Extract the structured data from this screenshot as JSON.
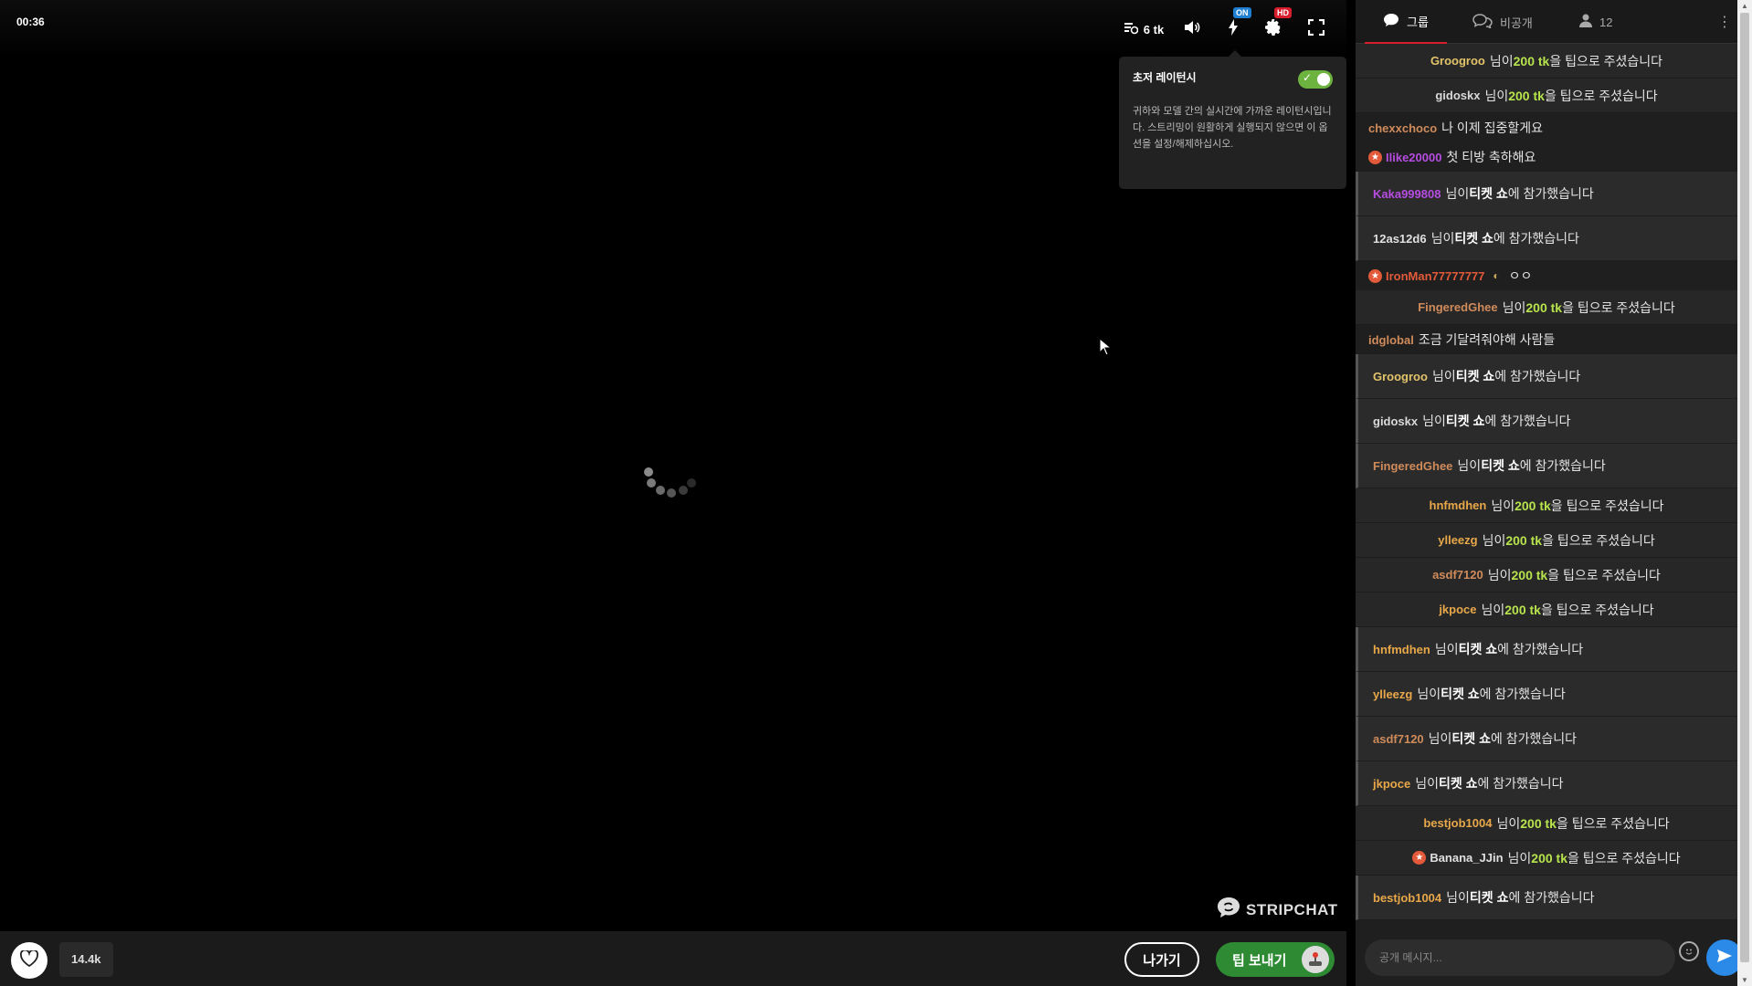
{
  "player": {
    "timer": "00:36",
    "tokens": "6 tk",
    "badges": {
      "latency": "ON",
      "quality": "HD"
    },
    "latency_panel": {
      "title": "초저 레이턴시",
      "description": "귀하와 모델 간의 실시간에 가까운 레이턴시입니다. 스트리밍이 원활하게 실행되지 않으면 이 옵션을 설정/해제하십시오.",
      "enabled": true
    },
    "brand": "STRIPCHAT",
    "icons": [
      "token-queue-icon",
      "volume-icon",
      "lightning-icon",
      "gear-icon",
      "fullscreen-icon",
      "loading-spinner-icon",
      "mouse-cursor-icon"
    ]
  },
  "bottombar": {
    "favorites": "14.4k",
    "leave_label": "나가기",
    "tip_label": "팁 보내기"
  },
  "chat": {
    "tabs": {
      "group": "그룹",
      "private": "비공개",
      "users": "12"
    },
    "input_placeholder": "공개 메시지...",
    "colors": {
      "tip_token": "#b7e34d",
      "tab_active_underline": "#d81e2c",
      "send_button": "#2b8ae8",
      "tip_button": "#2e8b33"
    },
    "messages": [
      {
        "type": "tip",
        "user": "Groogroo",
        "color": "#e3c46a",
        "pre": "님이 ",
        "amount": "200 tk",
        "post": "을 팁으로 주셨습니다"
      },
      {
        "type": "tip",
        "user": "gidoskx",
        "color": "#d9d9d9",
        "pre": "님이 ",
        "amount": "200 tk",
        "post": "을 팁으로 주셨습니다"
      },
      {
        "type": "chat",
        "user": "chexxchoco",
        "color": "#d08b5b",
        "text": "나 이제 집중할게요"
      },
      {
        "type": "chat",
        "user": "Ilike20000",
        "color": "#b64de0",
        "star": true,
        "text": "첫 티방 축하해요"
      },
      {
        "type": "join",
        "user": "Kaka999808",
        "color": "#b64de0",
        "pre": "님이 ",
        "strong": "티켓 쇼",
        "post": "에 참가했습니다"
      },
      {
        "type": "join",
        "user": "12as12d6",
        "color": "#e0e0e0",
        "pre": "님이 ",
        "strong": "티켓 쇼",
        "post": "에 참가했습니다"
      },
      {
        "type": "chat",
        "user": "IronMan77777777",
        "color": "#e25a3a",
        "star": true,
        "shield": true,
        "text": "ㅇㅇ"
      },
      {
        "type": "tip",
        "user": "FingeredGhee",
        "color": "#d08b5b",
        "pre": "님이 ",
        "amount": "200 tk",
        "post": "을 팁으로 주셨습니다"
      },
      {
        "type": "chat",
        "user": "idglobal",
        "color": "#d08b5b",
        "text": "조금 기달려줘야해 사람들"
      },
      {
        "type": "join",
        "user": "Groogroo",
        "color": "#e3c46a",
        "pre": "님이 ",
        "strong": "티켓 쇼",
        "post": "에 참가했습니다"
      },
      {
        "type": "join",
        "user": "gidoskx",
        "color": "#d9d9d9",
        "pre": "님이 ",
        "strong": "티켓 쇼",
        "post": "에 참가했습니다"
      },
      {
        "type": "join",
        "user": "FingeredGhee",
        "color": "#d08b5b",
        "pre": "님이 ",
        "strong": "티켓 쇼",
        "post": "에 참가했습니다"
      },
      {
        "type": "tip",
        "user": "hnfmdhen",
        "color": "#e8a84a",
        "pre": "님이 ",
        "amount": "200 tk",
        "post": "을 팁으로 주셨습니다"
      },
      {
        "type": "tip",
        "user": "ylleezg",
        "color": "#e8a84a",
        "pre": "님이 ",
        "amount": "200 tk",
        "post": "을 팁으로 주셨습니다"
      },
      {
        "type": "tip",
        "user": "asdf7120",
        "color": "#d08b5b",
        "pre": "님이 ",
        "amount": "200 tk",
        "post": "을 팁으로 주셨습니다"
      },
      {
        "type": "tip",
        "user": "jkpoce",
        "color": "#e8a84a",
        "pre": "님이 ",
        "amount": "200 tk",
        "post": "을 팁으로 주셨습니다"
      },
      {
        "type": "join",
        "user": "hnfmdhen",
        "color": "#e8a84a",
        "pre": "님이 ",
        "strong": "티켓 쇼",
        "post": "에 참가했습니다"
      },
      {
        "type": "join",
        "user": "ylleezg",
        "color": "#e8a84a",
        "pre": "님이 ",
        "strong": "티켓 쇼",
        "post": "에 참가했습니다"
      },
      {
        "type": "join",
        "user": "asdf7120",
        "color": "#d08b5b",
        "pre": "님이 ",
        "strong": "티켓 쇼",
        "post": "에 참가했습니다"
      },
      {
        "type": "join",
        "user": "jkpoce",
        "color": "#e8a84a",
        "pre": "님이 ",
        "strong": "티켓 쇼",
        "post": "에 참가했습니다"
      },
      {
        "type": "tip",
        "user": "bestjob1004",
        "color": "#e8a84a",
        "pre": "님이 ",
        "amount": "200 tk",
        "post": "을 팁으로 주셨습니다"
      },
      {
        "type": "tip",
        "user": "Banana_JJin",
        "color": "#e0e0e0",
        "star": true,
        "pre": "님이 ",
        "amount": "200 tk",
        "post": "을 팁으로 주셨습니다"
      },
      {
        "type": "join",
        "user": "bestjob1004",
        "color": "#e8a84a",
        "pre": "님이 ",
        "strong": "티켓 쇼",
        "post": "에 참가했습니다"
      }
    ]
  }
}
